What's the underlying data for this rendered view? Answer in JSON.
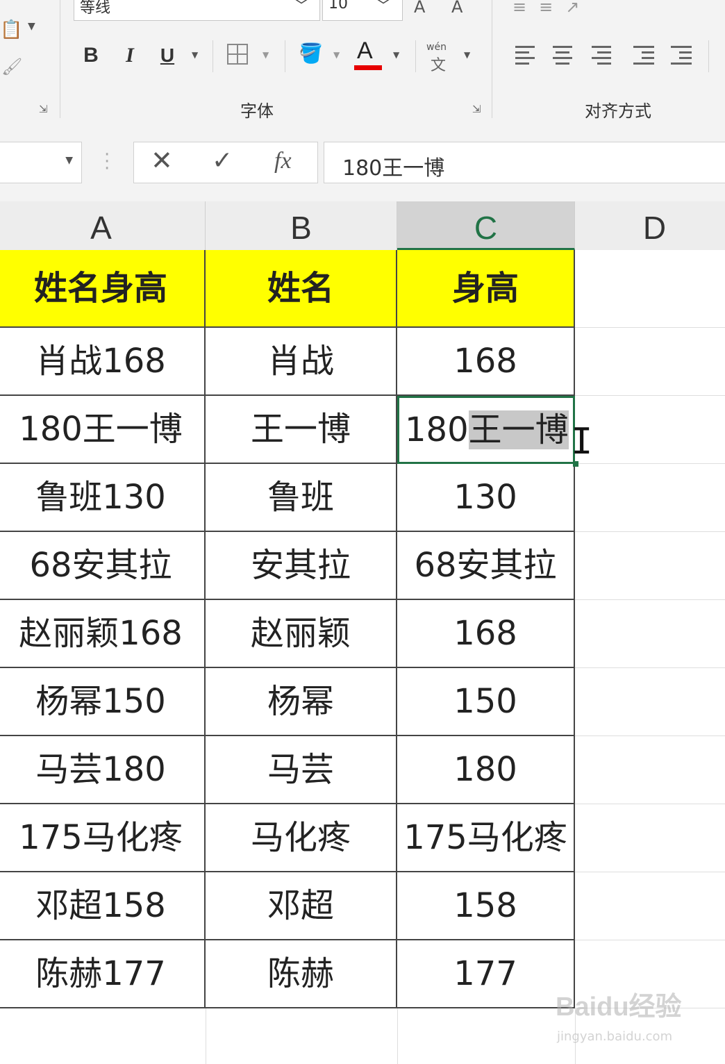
{
  "ribbon": {
    "font_name": "等线",
    "font_size": "10",
    "bold": "B",
    "italic": "I",
    "underline": "U",
    "font_color_letter": "A",
    "font_color": "#e60000",
    "phonetic_top": "wén",
    "phonetic_bottom": "文",
    "font_group_label": "字体",
    "align_group_label": "对齐方式"
  },
  "formula_bar": {
    "cancel": "✕",
    "enter": "✓",
    "fx": "fx",
    "content": "180王一博"
  },
  "columns": [
    "A",
    "B",
    "C",
    "D"
  ],
  "selected_column": "C",
  "table": {
    "header": [
      "姓名身高",
      "姓名",
      "身高"
    ],
    "rows": [
      [
        "肖战168",
        "肖战",
        "168"
      ],
      [
        "180王一博",
        "王一博",
        "180王一博"
      ],
      [
        "鲁班130",
        "鲁班",
        "130"
      ],
      [
        "68安其拉",
        "安其拉",
        "68安其拉"
      ],
      [
        "赵丽颖168",
        "赵丽颖",
        "168"
      ],
      [
        "杨幂150",
        "杨幂",
        "150"
      ],
      [
        "马芸180",
        "马芸",
        "180"
      ],
      [
        "175马化疼",
        "马化疼",
        "175马化疼"
      ],
      [
        "邓超158",
        "邓超",
        "158"
      ],
      [
        "陈赫177",
        "陈赫",
        "177"
      ]
    ]
  },
  "active_cell": {
    "plain": "180",
    "selected": "王一博"
  },
  "colors": {
    "header_fill": "#ffff00",
    "excel_green": "#217346"
  },
  "watermark": {
    "logo": "Baidu经验",
    "url": "jingyan.baidu.com"
  }
}
